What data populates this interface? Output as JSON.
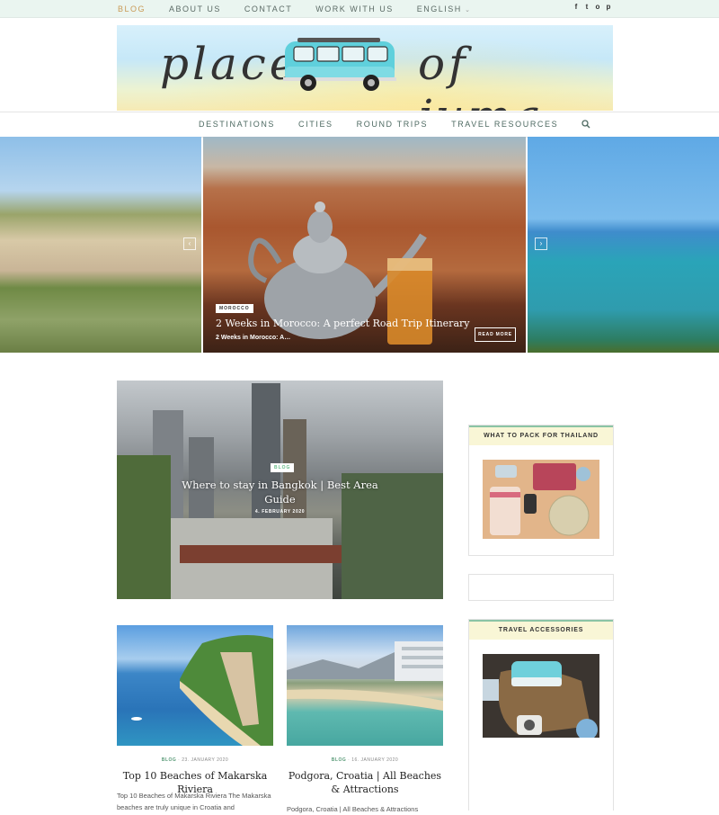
{
  "topnav": {
    "items": [
      "BLOG",
      "ABOUT US",
      "CONTACT",
      "WORK WITH US",
      "ENGLISH"
    ],
    "social_icons": [
      "facebook-icon",
      "twitter-icon",
      "instagram-icon",
      "pinterest-icon"
    ],
    "social_glyphs": [
      "f",
      "t",
      "o",
      "p"
    ]
  },
  "logo": {
    "text_1": "places",
    "text_2": "of juma"
  },
  "mainnav": {
    "items": [
      "DESTINATIONS",
      "CITIES",
      "ROUND TRIPS",
      "TRAVEL RESOURCES"
    ],
    "search_icon": "search-icon"
  },
  "slider": {
    "badge": "MOROCCO",
    "title": "2 Weeks in Morocco: A perfect Road Trip Itinerary",
    "subtitle": "2 Weeks in Morocco: A…",
    "read_more": "READ MORE",
    "prev_glyph": "‹",
    "next_glyph": "›"
  },
  "featured": {
    "badge": "BLOG",
    "title": "Where to stay in Bangkok | Best Area Guide",
    "date": "4. FEBRUARY 2020"
  },
  "cards": [
    {
      "category": "BLOG",
      "date": "23. JANUARY 2020",
      "title": "Top 10 Beaches of Makarska Riviera",
      "excerpt": "Top 10 Beaches of Makarska Riviera The Makarska beaches are truly unique in Croatia and"
    },
    {
      "category": "BLOG",
      "date": "16. JANUARY 2020",
      "title": "Podgora, Croatia | All Beaches & Attractions",
      "excerpt": "Podgora, Croatia | All Beaches & Attractions"
    }
  ],
  "sidebar": {
    "widget_1_title": "WHAT TO PACK FOR THAILAND",
    "widget_2_title": "TRAVEL ACCESSORIES"
  },
  "colors": {
    "topbar_bg": "#eaf5f0",
    "active_nav": "#c99a56",
    "nav_text": "#4e6a62",
    "widget_head_bg": "#f9f6d6",
    "widget_accent": "#8bc4a5"
  }
}
